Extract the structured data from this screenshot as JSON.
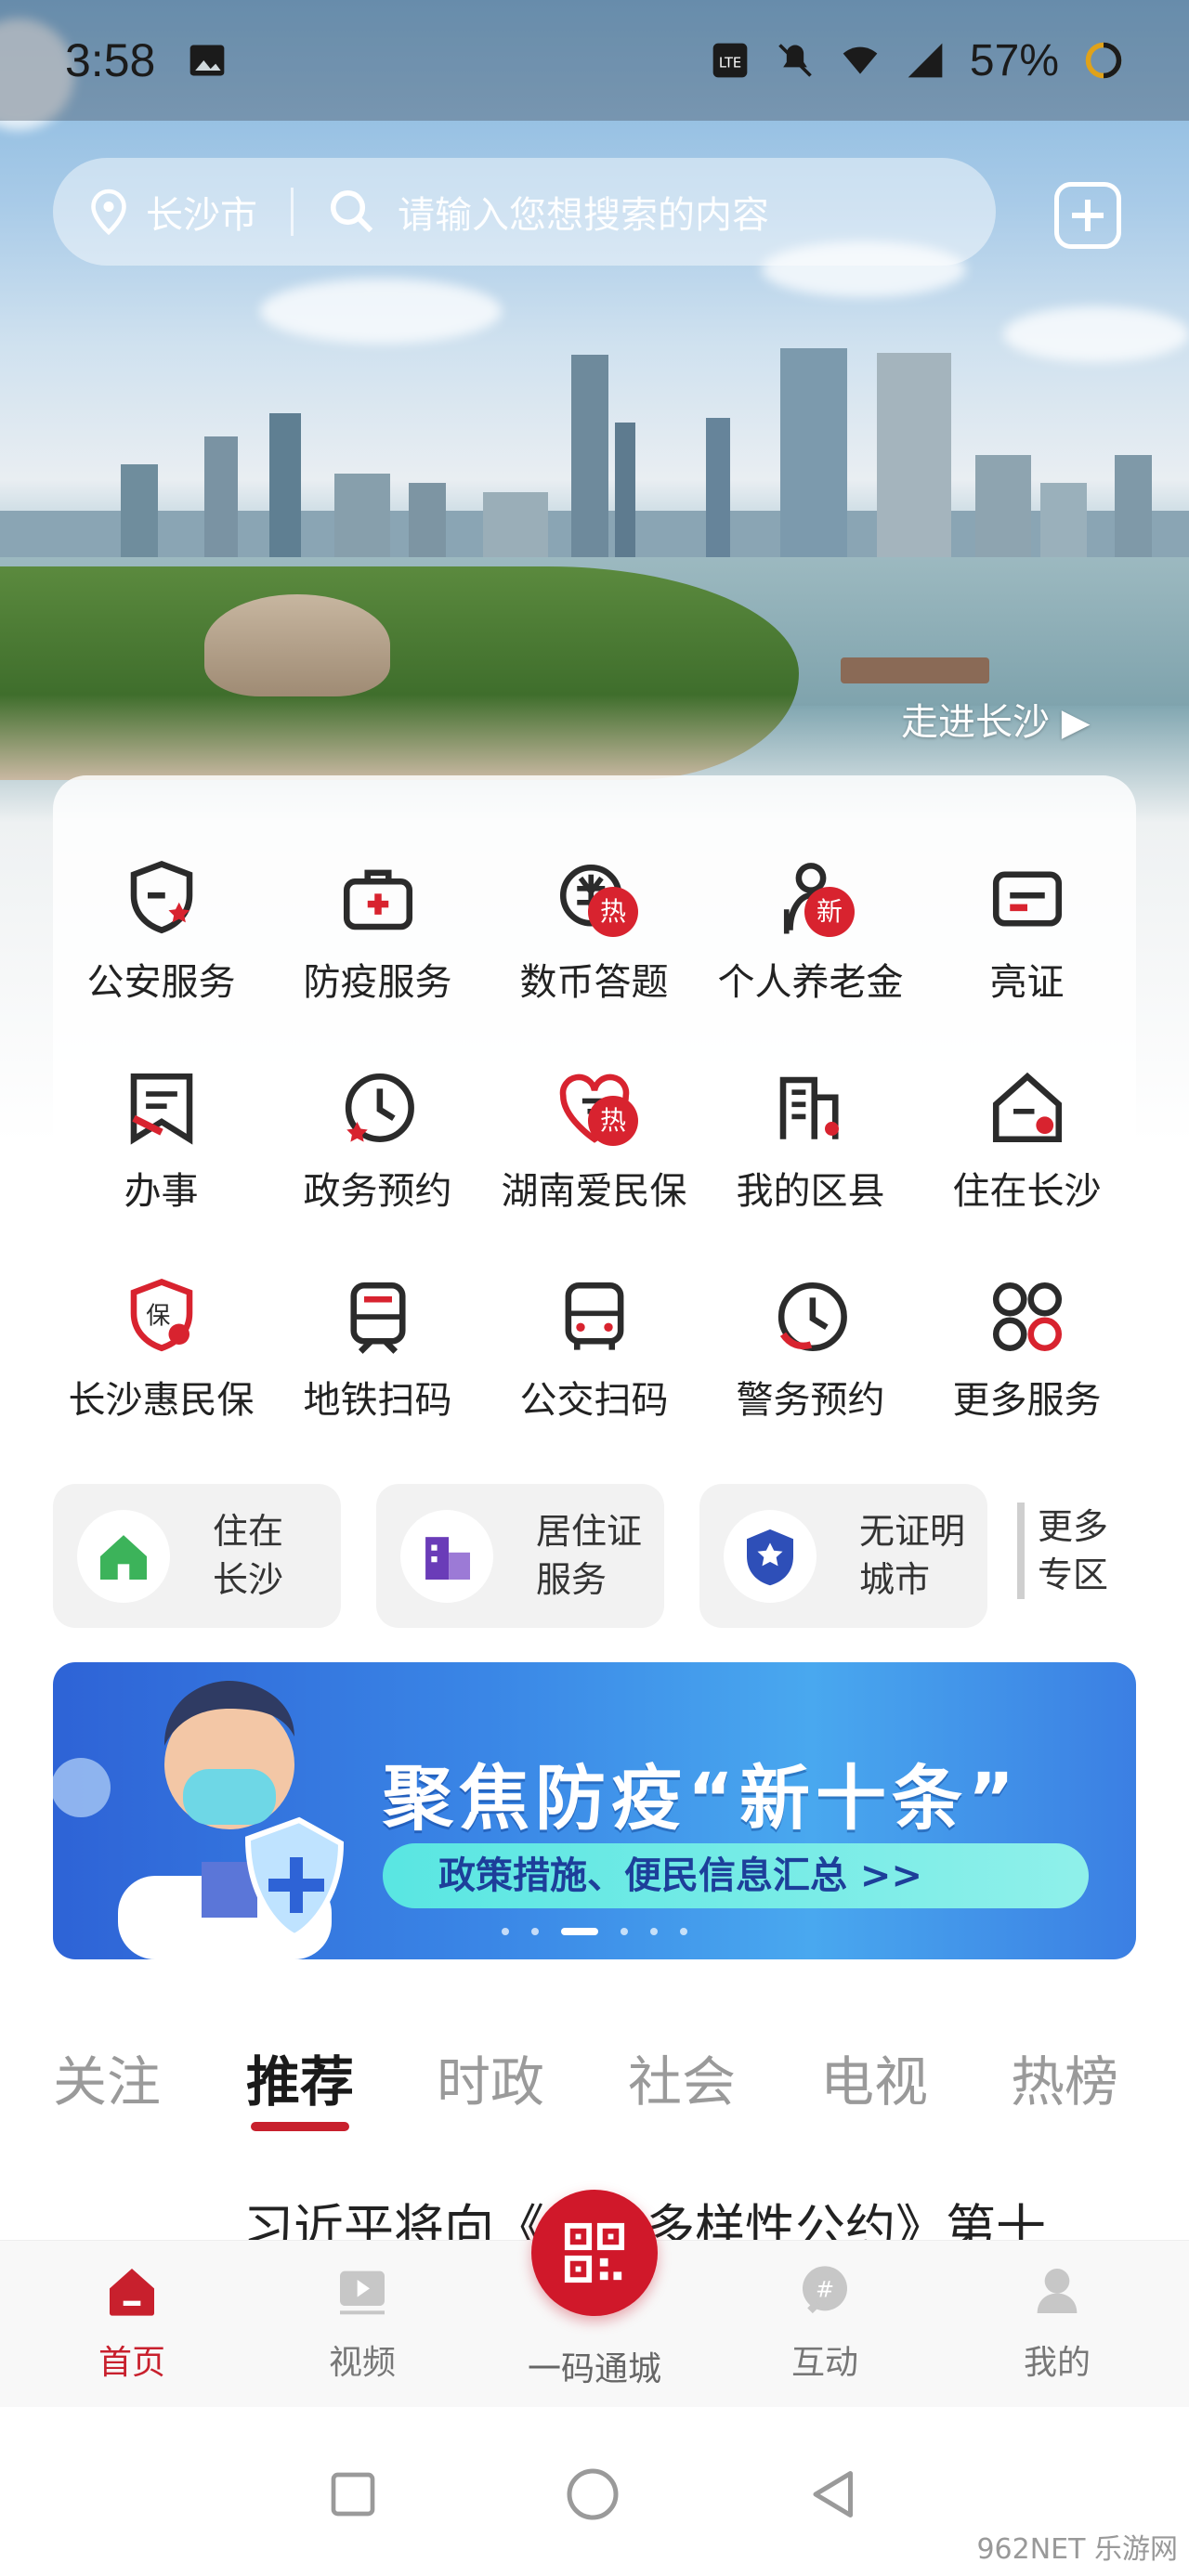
{
  "status_bar": {
    "time": "3:58",
    "battery": "57%",
    "network": "4G"
  },
  "search": {
    "city": "长沙市",
    "placeholder": "请输入您想搜索的内容"
  },
  "hero": {
    "walk_link": "走进长沙"
  },
  "services": [
    {
      "label": "公安服务",
      "icon": "police-shield-icon"
    },
    {
      "label": "防疫服务",
      "icon": "medical-kit-icon"
    },
    {
      "label": "数币答题",
      "icon": "digital-currency-icon",
      "badge": "热"
    },
    {
      "label": "个人养老金",
      "icon": "elderly-person-icon",
      "badge": "新"
    },
    {
      "label": "亮证",
      "icon": "id-card-icon"
    },
    {
      "label": "办事",
      "icon": "affairs-doc-icon"
    },
    {
      "label": "政务预约",
      "icon": "appointment-clock-icon"
    },
    {
      "label": "湖南爱民保",
      "icon": "heart-insurance-icon",
      "badge": "热"
    },
    {
      "label": "我的区县",
      "icon": "district-building-icon"
    },
    {
      "label": "住在长沙",
      "icon": "house-location-icon"
    },
    {
      "label": "长沙惠民保",
      "icon": "insurance-shield-icon"
    },
    {
      "label": "地铁扫码",
      "icon": "subway-icon"
    },
    {
      "label": "公交扫码",
      "icon": "bus-icon"
    },
    {
      "label": "警务预约",
      "icon": "police-clock-icon"
    },
    {
      "label": "更多服务",
      "icon": "more-grid-icon"
    }
  ],
  "quick_zones": [
    {
      "line1": "住在",
      "line2": "长沙",
      "icon": "green-house-icon"
    },
    {
      "line1": "居住证",
      "line2": "服务",
      "icon": "residence-building-icon"
    },
    {
      "line1": "无证明",
      "line2": "城市",
      "icon": "star-badge-icon"
    }
  ],
  "more_zones": {
    "line1": "更多",
    "line2": "专区"
  },
  "banner": {
    "title": "聚焦防疫“新十条”",
    "subtitle": "政策措施、便民信息汇总 >>",
    "active_slide": 3,
    "slides": 6
  },
  "tabs": [
    "关注",
    "推荐",
    "时政",
    "社会",
    "电视",
    "热榜"
  ],
  "active_tab": "推荐",
  "news_preview": "习近平将向《生物多样性公约》第十",
  "bottom_nav": {
    "home": "首页",
    "video": "视频",
    "scan": "一码通城",
    "interact": "互动",
    "mine": "我的"
  },
  "watermark": "962NET 乐游网",
  "colors": {
    "accent": "#c8202d",
    "banner_blue": "#3a86e6",
    "banner_teal": "#59e6e2"
  }
}
